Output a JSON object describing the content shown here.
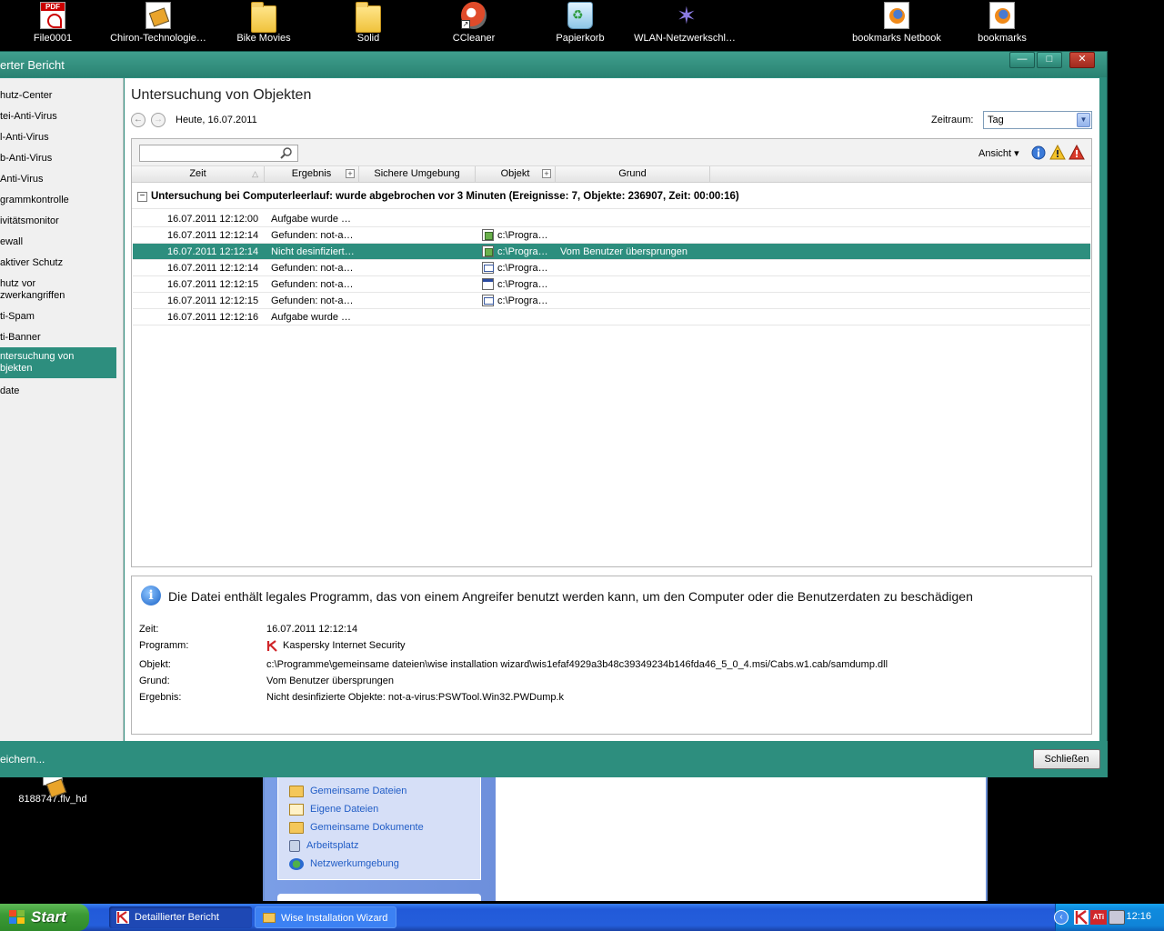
{
  "desktop": {
    "icons": [
      {
        "label": "File0001",
        "icon": "pdf-file-icon"
      },
      {
        "label": "Chiron-Technologie…",
        "icon": "video-file-icon"
      },
      {
        "label": "Bike Movies",
        "icon": "folder-icon"
      },
      {
        "label": "Solid",
        "icon": "folder-icon"
      },
      {
        "label": "CCleaner",
        "icon": "ccleaner-icon"
      },
      {
        "label": "Papierkorb",
        "icon": "recycle-bin-icon"
      },
      {
        "label": "WLAN-Netzwerkschl…",
        "icon": "wizard-icon"
      },
      {
        "label": "bookmarks Netbook",
        "icon": "firefox-document-icon"
      },
      {
        "label": "bookmarks",
        "icon": "firefox-document-icon"
      }
    ],
    "lower_icon": {
      "label": "8188747.flv_hd",
      "icon": "video-file-icon"
    }
  },
  "explorer_bg": {
    "tasks": [
      {
        "label": "Gemeinsame Dateien",
        "icon": "folder-icon"
      },
      {
        "label": "Eigene Dateien",
        "icon": "documents-icon"
      },
      {
        "label": "Gemeinsame Dokumente",
        "icon": "folder-icon"
      },
      {
        "label": "Arbeitsplatz",
        "icon": "computer-icon"
      },
      {
        "label": "Netzwerkumgebung",
        "icon": "network-icon"
      }
    ]
  },
  "window": {
    "title": "erter Bericht",
    "controls": {
      "minimize": "—",
      "maximize": "□",
      "close": "✕"
    },
    "sidebar": [
      {
        "label": "hutz-Center"
      },
      {
        "label": "tei-Anti-Virus"
      },
      {
        "label": "l-Anti-Virus"
      },
      {
        "label": "b-Anti-Virus"
      },
      {
        "label": "Anti-Virus"
      },
      {
        "label": "grammkontrolle"
      },
      {
        "label": "ivitätsmonitor"
      },
      {
        "label": "ewall"
      },
      {
        "label": "aktiver Schutz"
      },
      {
        "label": "hutz vor\nzwerkangriffen"
      },
      {
        "label": "ti-Spam"
      },
      {
        "label": "ti-Banner"
      },
      {
        "label": "ntersuchung von\nbjekten"
      },
      {
        "label": "date"
      }
    ],
    "active_index": 12,
    "page_title": "Untersuchung von Objekten",
    "date_label": "Heute, 16.07.2011",
    "period_label": "Zeitraum:",
    "period_value": "Tag",
    "search_placeholder": "",
    "view_label": "Ansicht ▾",
    "columns": {
      "time": "Zeit",
      "result": "Ergebnis",
      "safe_env": "Sichere Umgebung",
      "object": "Objekt",
      "reason": "Grund"
    },
    "group_header": "Untersuchung bei Computerleerlauf: wurde abgebrochen vor 3 Minuten  (Ereignisse: 7, Objekte: 236907, Zeit: 00:00:16)",
    "rows": [
      {
        "time": "16.07.2011 12:12:00",
        "result": "Aufgabe wurde …",
        "object": "",
        "reason": "",
        "icon": ""
      },
      {
        "time": "16.07.2011 12:12:14",
        "result": "Gefunden: not-a…",
        "object": "c:\\Progra…",
        "reason": "",
        "icon": "exe"
      },
      {
        "time": "16.07.2011 12:12:14",
        "result": "Nicht desinfiziert…",
        "object": "c:\\Progra…",
        "reason": "Vom Benutzer übersprungen",
        "icon": "exe"
      },
      {
        "time": "16.07.2011 12:12:14",
        "result": "Gefunden: not-a…",
        "object": "c:\\Progra…",
        "reason": "",
        "icon": "dll"
      },
      {
        "time": "16.07.2011 12:12:15",
        "result": "Gefunden: not-a…",
        "object": "c:\\Progra…",
        "reason": "",
        "icon": "win"
      },
      {
        "time": "16.07.2011 12:12:15",
        "result": "Gefunden: not-a…",
        "object": "c:\\Progra…",
        "reason": "",
        "icon": "dll"
      },
      {
        "time": "16.07.2011 12:12:16",
        "result": "Aufgabe wurde …",
        "object": "",
        "reason": "",
        "icon": ""
      }
    ],
    "selected_row": 2,
    "detail": {
      "message": "Die Datei  enthält legales Programm, das von einem Angreifer benutzt werden kann, um den Computer oder die Benutzerdaten zu beschädigen",
      "time_label": "Zeit:",
      "time_value": "16.07.2011 12:12:14",
      "program_label": "Programm:",
      "program_value": "Kaspersky Internet Security",
      "object_label": "Objekt:",
      "object_value": "c:\\Programme\\gemeinsame dateien\\wise installation wizard\\wis1efaf4929a3b48c39349234b146fda46_5_0_4.msi/Cabs.w1.cab/samdump.dll",
      "reason_label": "Grund:",
      "reason_value": "Vom Benutzer übersprungen",
      "result_label": "Ergebnis:",
      "result_value": "Nicht desinfizierte Objekte: not-a-virus:PSWTool.Win32.PWDump.k"
    },
    "footer_save": "eichern...",
    "close_button": "Schließen"
  },
  "taskbar": {
    "start": "Start",
    "buttons": [
      {
        "label": "Detaillierter Bericht",
        "active": true
      },
      {
        "label": "Wise Installation Wizard",
        "active": false
      }
    ],
    "clock": "12:16"
  },
  "colors": {
    "accent": "#2d8e7e",
    "taskbar": "#245edb",
    "start": "#3c9a36"
  }
}
